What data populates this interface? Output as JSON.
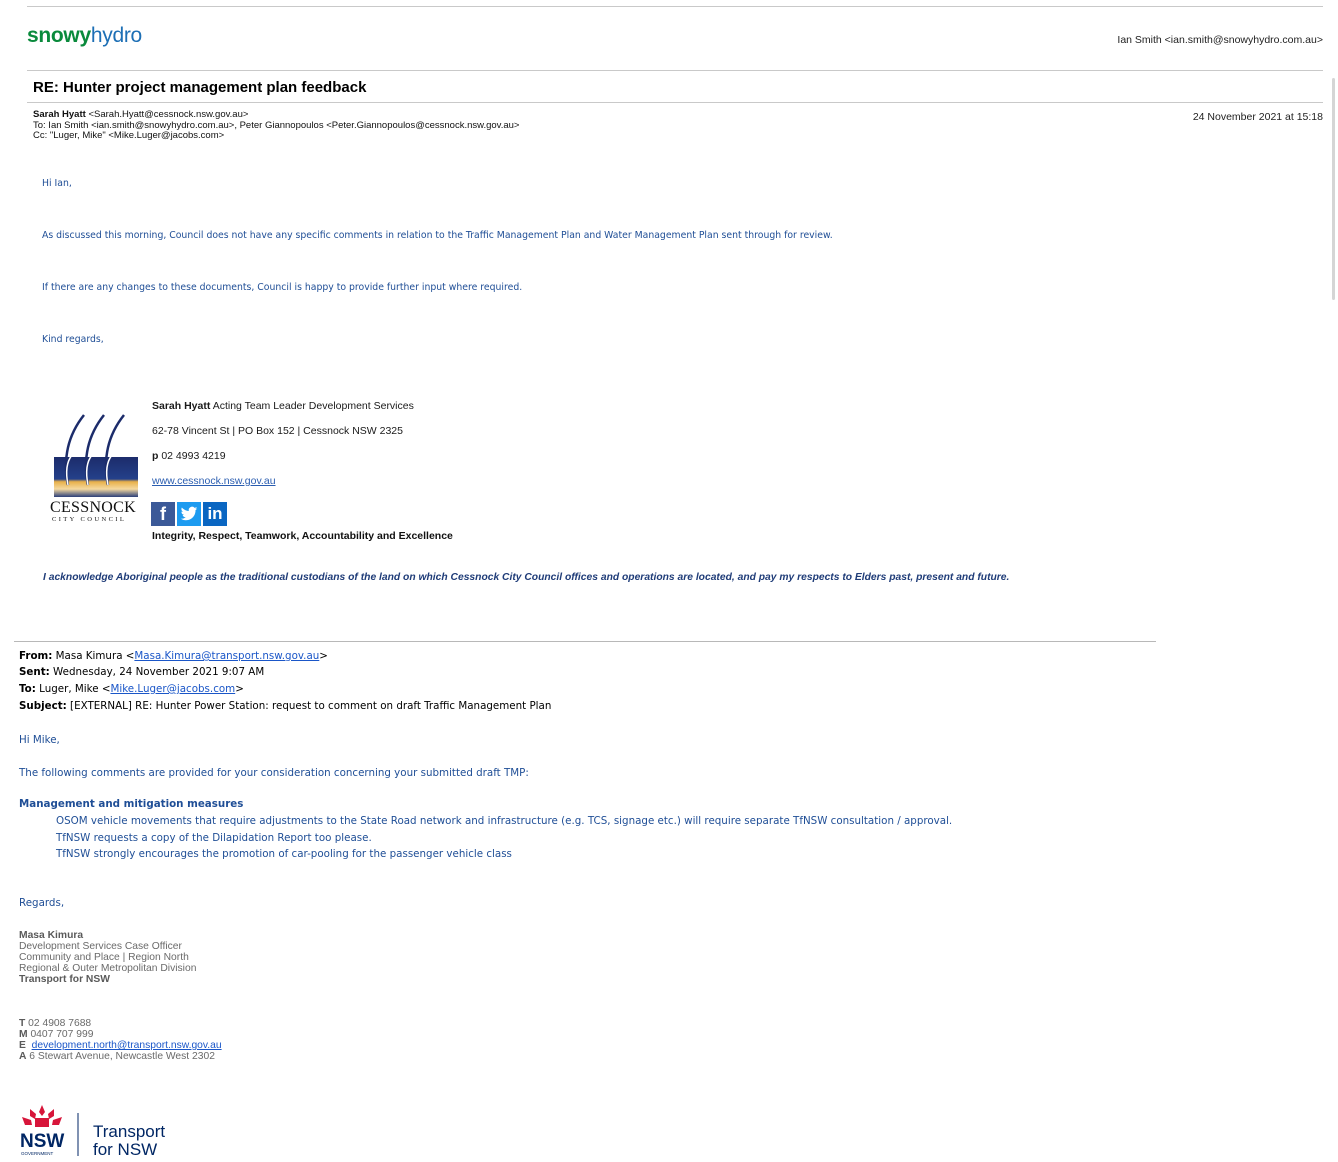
{
  "top_email": {
    "brand": {
      "part1": "snowy",
      "part2": "hydro"
    },
    "account": "Ian Smith <ian.smith@snowyhydro.com.au>",
    "subject": "RE: Hunter project management plan feedback",
    "from_name": "Sarah Hyatt",
    "from_addr": " <Sarah.Hyatt@cessnock.nsw.gov.au>",
    "to": "To: Ian Smith <ian.smith@snowyhydro.com.au>, Peter Giannopoulos <Peter.Giannopoulos@cessnock.nsw.gov.au>",
    "cc": "Cc: \"Luger, Mike\" <Mike.Luger@jacobs.com>",
    "date": "24 November 2021 at 15:18",
    "body": {
      "greeting": "Hi Ian,",
      "p1": "As discussed this morning, Council does not have any specific comments in relation to the Traffic Management Plan and Water Management Plan sent through for review.",
      "p2": "If there are any changes to these documents, Council is happy to provide further input where required.",
      "closing": "Kind regards,"
    },
    "signature": {
      "name": "Sarah Hyatt",
      "title": " Acting Team Leader Development Services",
      "address": "62-78 Vincent St | PO Box 152 | Cessnock NSW 2325",
      "phone_label": "p",
      "phone": " 02 4993 4219",
      "website": "www.cessnock.nsw.gov.au",
      "values": "Integrity, Respect, Teamwork, Accountability and Excellence",
      "logo_name": "CESSNOCK",
      "logo_sub": "CITY COUNCIL"
    },
    "acknowledgement": "I acknowledge Aboriginal people as the traditional custodians of the land on which Cessnock City Council offices and operations are located, and pay my respects to Elders past, present and future."
  },
  "bottom_email": {
    "from_label": "From:",
    "from_name": " Masa Kimura <",
    "from_email": "Masa.Kimura@transport.nsw.gov.au",
    "from_end": ">",
    "sent_label": "Sent:",
    "sent": " Wednesday, 24 November 2021 9:07 AM",
    "to_label": "To:",
    "to_name": " Luger, Mike <",
    "to_email": "Mike.Luger@jacobs.com",
    "to_end": ">",
    "subject_label": "Subject:",
    "subject": " [EXTERNAL] RE: Hunter Power Station: request to comment on draft Traffic Management Plan",
    "greeting": "Hi Mike,",
    "intro": "The following comments are provided for your consideration concerning your submitted draft TMP:",
    "section_heading": "Management and mitigation measures",
    "items": [
      "OSOM vehicle movements that require adjustments to the State Road network and infrastructure (e.g. TCS, signage etc.) will require separate TfNSW consultation / approval.",
      "TfNSW requests a copy of the Dilapidation Report too please.",
      "TfNSW strongly encourages the promotion of car-pooling for the passenger vehicle class"
    ],
    "closing": "Regards,",
    "signature": {
      "name": "Masa Kimura",
      "title": "Development Services Case Officer",
      "line2": "Community and Place | Region North",
      "line3": "Regional & Outer Metropolitan Division",
      "org": "Transport for NSW",
      "t_label": "T",
      "t": "  02 4908 7688",
      "m_label": "M",
      "m": " 0407 707 999",
      "e_label": "E",
      "e": "development.north@transport.nsw.gov.au",
      "a_label": "A",
      "a": "  6 Stewart Avenue, Newcastle West 2302"
    },
    "logo": {
      "nsw": "NSW",
      "gov": "GOVERNMENT",
      "transport": "Transport",
      "for_nsw": "for NSW"
    }
  }
}
